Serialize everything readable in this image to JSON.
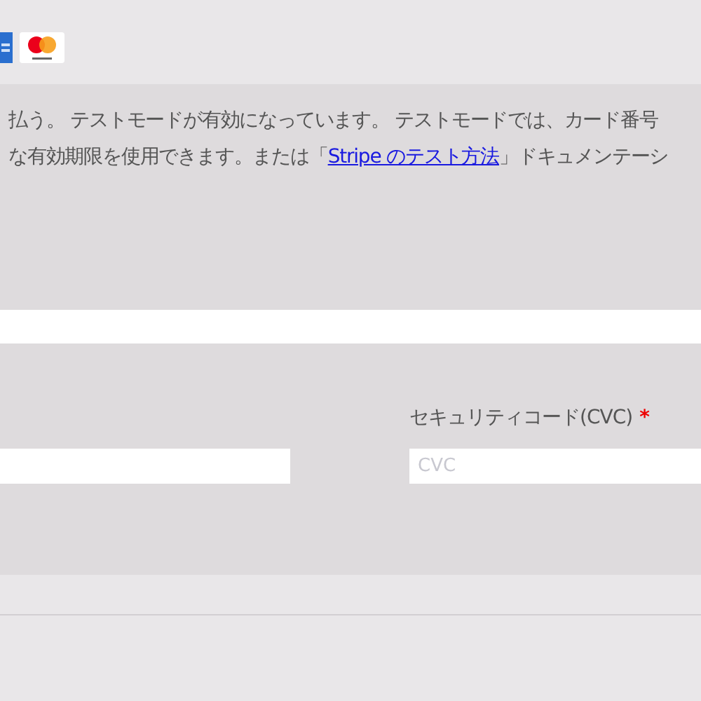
{
  "card_brands": [
    {
      "kind": "blue_card"
    },
    {
      "kind": "mastercard"
    }
  ],
  "notice": {
    "line_1": "払う。 テストモードが有効になっています。 テストモードでは、カード番号",
    "line_2_before": "な有効期限を使用できます。または「",
    "link": "Stripe のテスト方法",
    "line_2_after": "」ドキュメンテーシ"
  },
  "cvc": {
    "label": "セキュリティコード(CVC)",
    "required": "*",
    "placeholder": "CVC"
  }
}
